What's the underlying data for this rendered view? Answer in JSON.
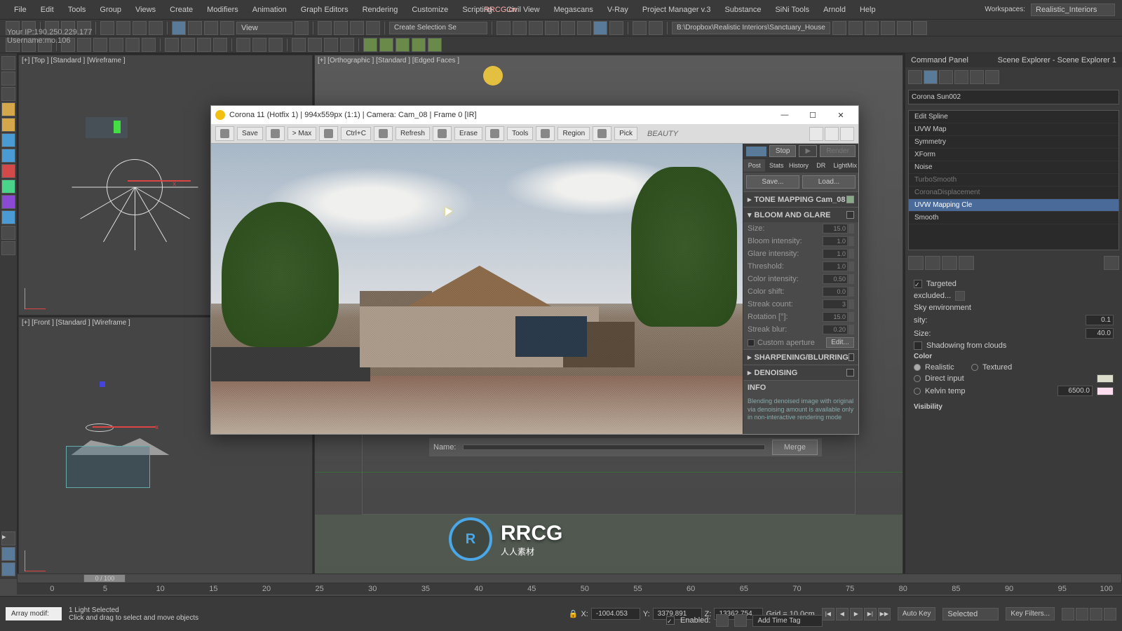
{
  "watermark_url": "RRCG.cn",
  "watermark_main": "RRCG",
  "watermark_sub": "人人素材",
  "ip_overlay_l1": "Your IP:190.250.229.177",
  "ip_overlay_l2": "Username:mo.106",
  "menu": [
    "File",
    "Edit",
    "Tools",
    "Group",
    "Views",
    "Create",
    "Modifiers",
    "Animation",
    "Graph Editors",
    "Rendering",
    "Customize",
    "Scripting",
    "Civil View",
    "Megascans",
    "V-Ray",
    "Project Manager v.3",
    "Substance",
    "SiNi Tools",
    "Arnold",
    "Help"
  ],
  "workspace_label": "Workspaces:",
  "workspace_value": "Realistic_Interiors",
  "toolbar_selector": "View",
  "toolbar_field": "Create Selection Se",
  "toolbar_path": "B:\\Dropbox\\Realistic Interiors\\Sanctuary_House",
  "viewports": {
    "top": "[+] [Top ] [Standard ] [Wireframe ]",
    "ortho": "[+] [Orthographic ] [Standard ] [Edged Faces ]",
    "front": "[+] [Front ] [Standard ] [Wireframe ]"
  },
  "command_panel": {
    "header_l": "Command Panel",
    "header_r": "Scene Explorer - Scene Explorer 1",
    "name": "Corona Sun002",
    "modifiers": [
      "Edit Spline",
      "UVW Map",
      "Symmetry",
      "XForm",
      "Noise",
      "TurboSmooth",
      "CoronaDisplacement",
      "UVW Mapping Cle",
      "Smooth"
    ],
    "section_targeted": "Targeted",
    "section_excluded": "excluded...",
    "section_sky_env": "Sky environment",
    "intensity_label": "sity:",
    "intensity_val": "0.1",
    "size_label": "Size:",
    "size_val": "40.0",
    "shadow_clouds": "Shadowing from clouds",
    "color_header": "Color",
    "realistic": "Realistic",
    "textured": "Textured",
    "direct_input": "Direct input",
    "kelvin": "Kelvin temp",
    "kelvin_val": "6500.0",
    "visibility": "Visibility"
  },
  "corona": {
    "title": "Corona 11 (Hotfix 1) | 994x559px (1:1) | Camera: Cam_08 | Frame 0 [IR]",
    "buttons": {
      "save": "Save",
      "tomax": "> Max",
      "ctrlc": "Ctrl+C",
      "refresh": "Refresh",
      "erase": "Erase",
      "tools": "Tools",
      "region": "Region",
      "pick": "Pick",
      "stop": "Stop",
      "render": "Render"
    },
    "pass": "BEAUTY",
    "side_tabs": [
      "Post",
      "Stats",
      "History",
      "DR",
      "LightMix"
    ],
    "side_btn_save": "Save...",
    "side_btn_load": "Load...",
    "tone_mapping": "TONE MAPPING  Cam_08",
    "bloom_glare": "BLOOM AND GLARE",
    "props": [
      {
        "l": "Size:",
        "v": "15.0"
      },
      {
        "l": "Bloom intensity:",
        "v": "1.0"
      },
      {
        "l": "Glare intensity:",
        "v": "1.0"
      },
      {
        "l": "Threshold:",
        "v": "1.0"
      },
      {
        "l": "Color intensity:",
        "v": "0.50"
      },
      {
        "l": "Color shift:",
        "v": "0.0"
      },
      {
        "l": "Streak count:",
        "v": "3"
      },
      {
        "l": "Rotation [°]:",
        "v": "15.0"
      },
      {
        "l": "Streak blur:",
        "v": "0.20"
      }
    ],
    "custom_aperture": "Custom aperture",
    "edit_btn": "Edit...",
    "sharpening": "SHARPENING/BLURRING",
    "denoising": "DENOISING",
    "info_head": "INFO",
    "info_text": "Blending denoised image with original via denoising amount is available only in non-interactive rendering mode"
  },
  "merge": {
    "name_label": "Name:",
    "btn": "Merge"
  },
  "timeline": {
    "slider": "0 / 100",
    "ticks": [
      "0",
      "5",
      "10",
      "15",
      "20",
      "25",
      "30",
      "35",
      "40",
      "45",
      "50",
      "55",
      "60",
      "65",
      "70",
      "75",
      "80",
      "85",
      "90",
      "95",
      "100"
    ]
  },
  "status": {
    "array_modif": "Array modif:",
    "selected": "1 Light Selected",
    "hint": "Click and drag to select and move objects",
    "enabled": "Enabled:",
    "add_time_tag": "Add Time Tag",
    "x": "X:",
    "xv": "-1004.053",
    "y": "Y:",
    "yv": "3379.891",
    "z": "Z:",
    "zv": "13362.754",
    "grid": "Grid = 10.0cm",
    "autokey": "Auto Key",
    "selected_combo": "Selected",
    "keyfilters": "Key Filters..."
  }
}
